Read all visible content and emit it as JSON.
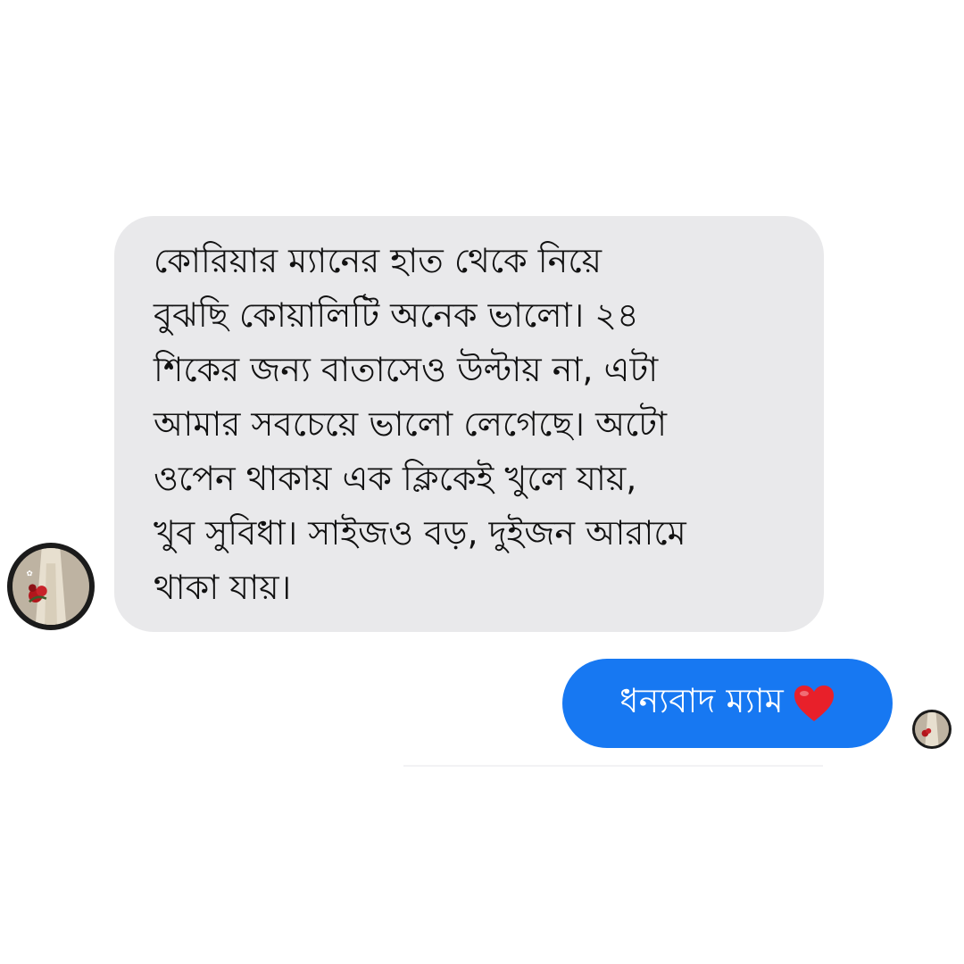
{
  "conversation": {
    "incoming_message": {
      "lines": [
        "কোরিয়ার ম্যানের হাত থেকে  নিয়ে",
        "বুঝছি কোয়ালিটি অনেক ভালো। ২৪",
        "শিকের জন্য বাতাসেও উল্টায় না, এটা",
        "আমার সবচেয়ে ভালো লেগেছে। অটো",
        "ওপেন থাকায় এক ক্লিকেই খুলে যায়,",
        "খুব সুবিধা। সাইজও বড়, দুইজন আরামে",
        "থাকা যায়।"
      ]
    },
    "outgoing_message": {
      "text": "ধন্যবাদ ম্যাম",
      "emoji_icon": "heart-icon"
    }
  },
  "colors": {
    "incoming_bubble": "#e9e9eb",
    "outgoing_bubble": "#1778f2",
    "heart": "#e8202a"
  }
}
